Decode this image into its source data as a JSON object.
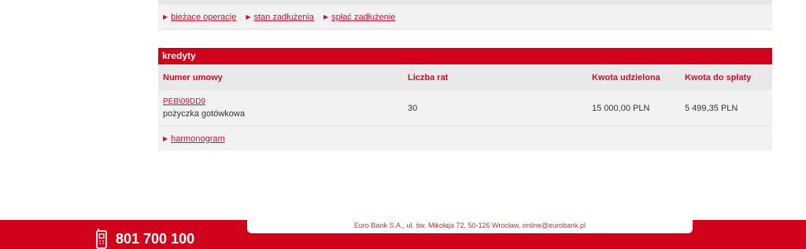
{
  "top_links": [
    "bieżace operacje",
    "stan zadłużenia",
    "spłać zadłużenie"
  ],
  "credits": {
    "title": "kredyty",
    "columns": [
      "Numer umowy",
      "Liczba rat",
      "Kwota udzielona",
      "Kwota do spłaty"
    ],
    "rows": [
      {
        "contract_no": "PEB\\09DD9",
        "product": "pożyczka gotówkowa",
        "installments": "30",
        "granted": "15 000,00 PLN",
        "to_repay": "5 499,35 PLN"
      }
    ],
    "links": [
      "harmonogram"
    ]
  },
  "footer": {
    "address": "Euro Bank S.A., ul. św. Mikołaja 72, 50-126 Wrocław, online@eurobank.pl",
    "phone": "801 700 100",
    "phone_icon": "mobile-phone-icon"
  },
  "colors": {
    "brand_red": "#d0021b",
    "link_red": "#c8102e"
  }
}
